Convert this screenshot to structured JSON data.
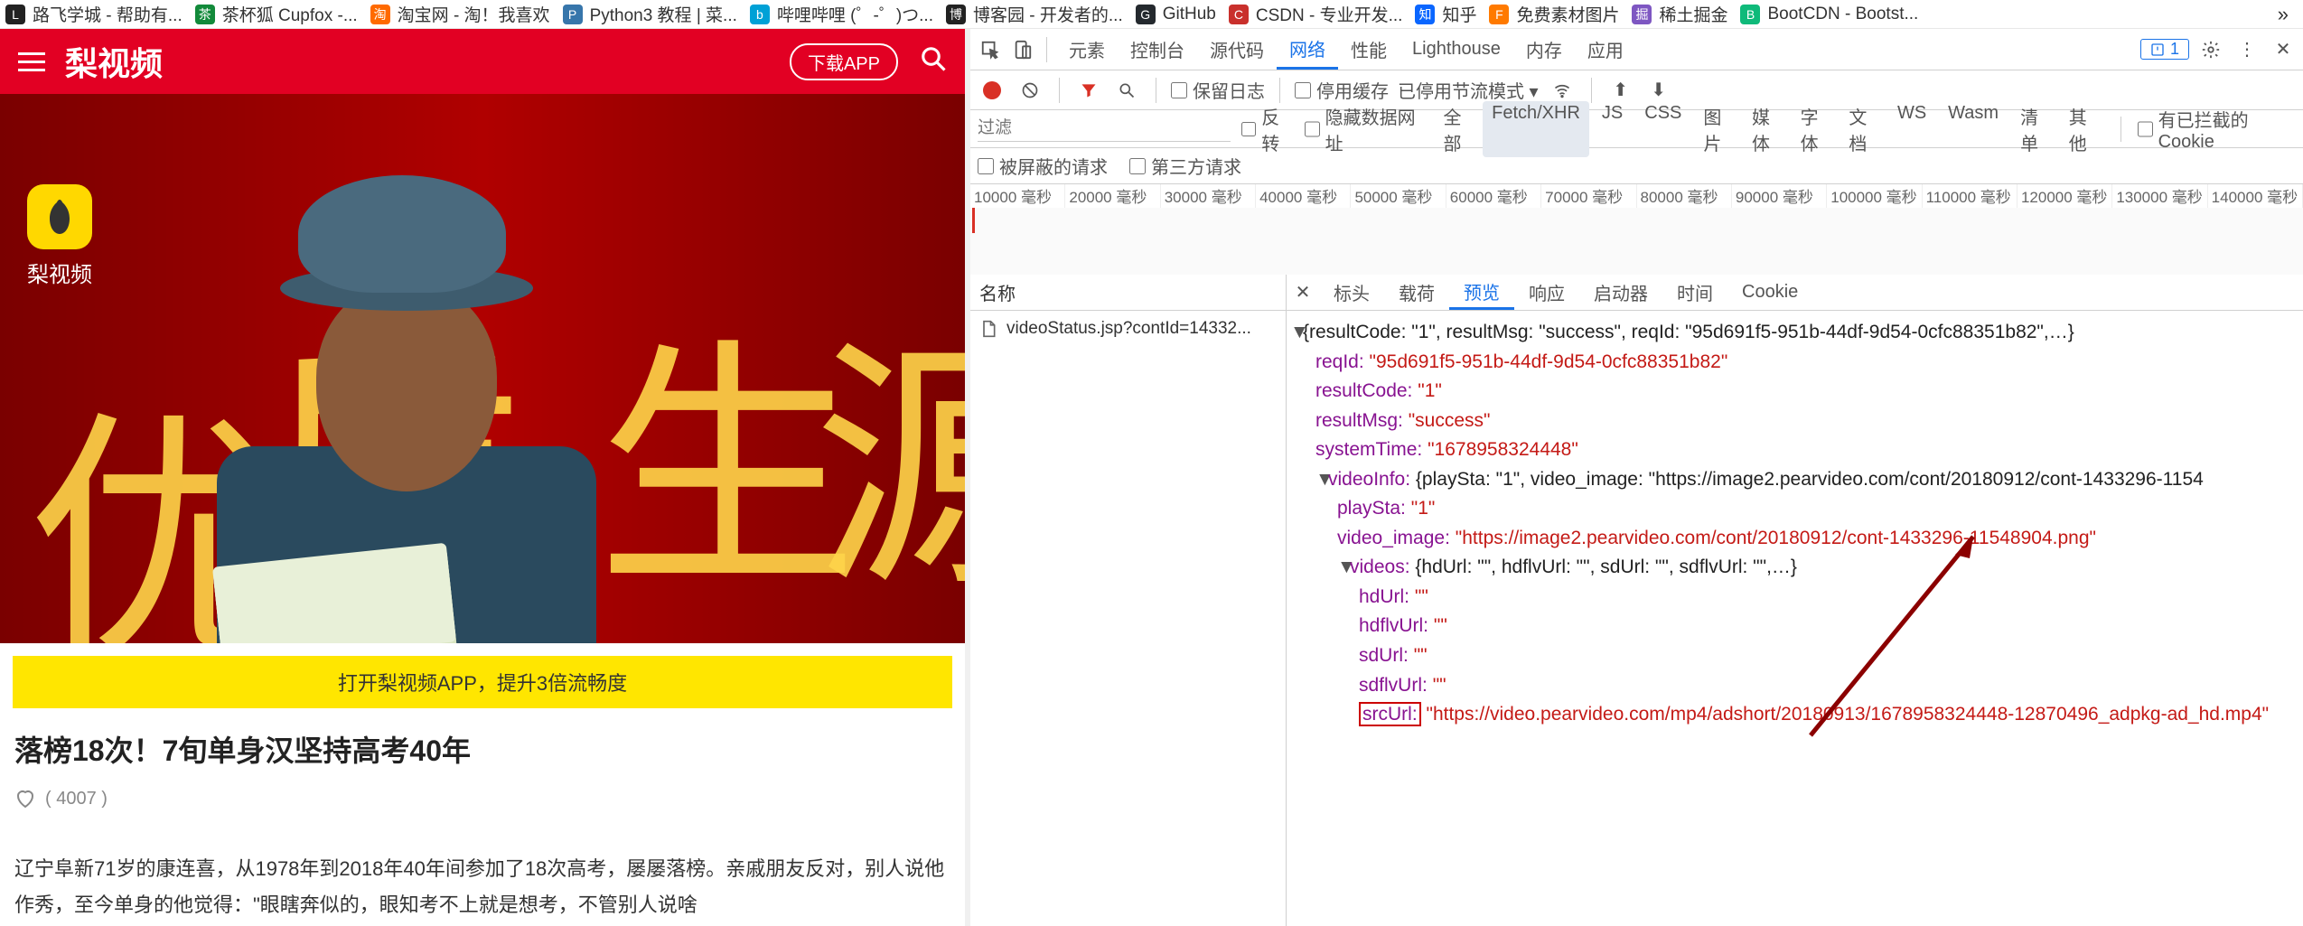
{
  "bookmarks": [
    {
      "label": "路飞学城 - 帮助有..."
    },
    {
      "label": "茶杯狐 Cupfox -..."
    },
    {
      "label": "淘宝网 - 淘！我喜欢"
    },
    {
      "label": "Python3 教程 | 菜..."
    },
    {
      "label": "哔哩哔哩 (゜-゜)つ..."
    },
    {
      "label": "博客园 - 开发者的..."
    },
    {
      "label": "GitHub"
    },
    {
      "label": "CSDN - 专业开发..."
    },
    {
      "label": "知乎"
    },
    {
      "label": "免费素材图片"
    },
    {
      "label": "稀土掘金"
    },
    {
      "label": "BootCDN - Bootst..."
    }
  ],
  "page": {
    "site_name": "梨视频",
    "download_btn": "下载APP",
    "brand_overlay": "梨视频",
    "open_app_bar": "打开梨视频APP，提升3倍流畅度",
    "title": "落榜18次！7旬单身汉坚持高考40年",
    "likes": "( 4007 )",
    "desc": "辽宁阜新71岁的康连喜，从1978年到2018年40年间参加了18次高考，屡屡落榜。亲戚朋友反对，别人说他作秀，至今单身的他觉得：\"眼瞎奔似的，眼知考不上就是想考，不管别人说啥"
  },
  "devtools": {
    "tabs": [
      "元素",
      "控制台",
      "源代码",
      "网络",
      "性能",
      "Lighthouse",
      "内存",
      "应用"
    ],
    "active_tab": "网络",
    "issues_count": "1",
    "toolbar": {
      "preserve_log": "保留日志",
      "disable_cache": "停用缓存",
      "throttling": "已停用节流模式"
    },
    "filter": {
      "placeholder": "过滤",
      "invert": "反转",
      "hide_data": "隐藏数据网址",
      "chips": [
        "全部",
        "Fetch/XHR",
        "JS",
        "CSS",
        "图片",
        "媒体",
        "字体",
        "文档",
        "WS",
        "Wasm",
        "清单",
        "其他"
      ],
      "active_chip": "Fetch/XHR",
      "blocked_cookies": "有已拦截的 Cookie"
    },
    "hidden_row": {
      "blocked": "被屏蔽的请求",
      "third": "第三方请求"
    },
    "timeline_labels": [
      "10000 毫秒",
      "20000 毫秒",
      "30000 毫秒",
      "40000 毫秒",
      "50000 毫秒",
      "60000 毫秒",
      "70000 毫秒",
      "80000 毫秒",
      "90000 毫秒",
      "100000 毫秒",
      "110000 毫秒",
      "120000 毫秒",
      "130000 毫秒",
      "140000 毫秒"
    ],
    "req_list_hd": "名称",
    "req_row": "videoStatus.jsp?contId=14332...",
    "resp_tabs": [
      "标头",
      "载荷",
      "预览",
      "响应",
      "启动器",
      "时间",
      "Cookie"
    ],
    "resp_active": "预览",
    "json": {
      "root_summary": "{resultCode: \"1\", resultMsg: \"success\", reqId: \"95d691f5-951b-44df-9d54-0cfc88351b82\",…}",
      "reqId_k": "reqId:",
      "reqId_v": "\"95d691f5-951b-44df-9d54-0cfc88351b82\"",
      "resultCode_k": "resultCode:",
      "resultCode_v": "\"1\"",
      "resultMsg_k": "resultMsg:",
      "resultMsg_v": "\"success\"",
      "systemTime_k": "systemTime:",
      "systemTime_v": "\"1678958324448\"",
      "videoInfo_k": "videoInfo:",
      "videoInfo_sum": "{playSta: \"1\", video_image: \"https://image2.pearvideo.com/cont/20180912/cont-1433296-1154",
      "playSta_k": "playSta:",
      "playSta_v": "\"1\"",
      "video_image_k": "video_image:",
      "video_image_v": "\"https://image2.pearvideo.com/cont/20180912/cont-1433296-11548904.png\"",
      "videos_k": "videos:",
      "videos_sum": "{hdUrl: \"\", hdflvUrl: \"\", sdUrl: \"\", sdflvUrl: \"\",…}",
      "hdUrl_k": "hdUrl:",
      "hdUrl_v": "\"\"",
      "hdflvUrl_k": "hdflvUrl:",
      "hdflvUrl_v": "\"\"",
      "sdUrl_k": "sdUrl:",
      "sdUrl_v": "\"\"",
      "sdflvUrl_k": "sdflvUrl:",
      "sdflvUrl_v": "\"\"",
      "srcUrl_k": "srcUrl:",
      "srcUrl_v": "\"https://video.pearvideo.com/mp4/adshort/20180913/1678958324448-12870496_adpkg-ad_hd.mp4\""
    }
  }
}
